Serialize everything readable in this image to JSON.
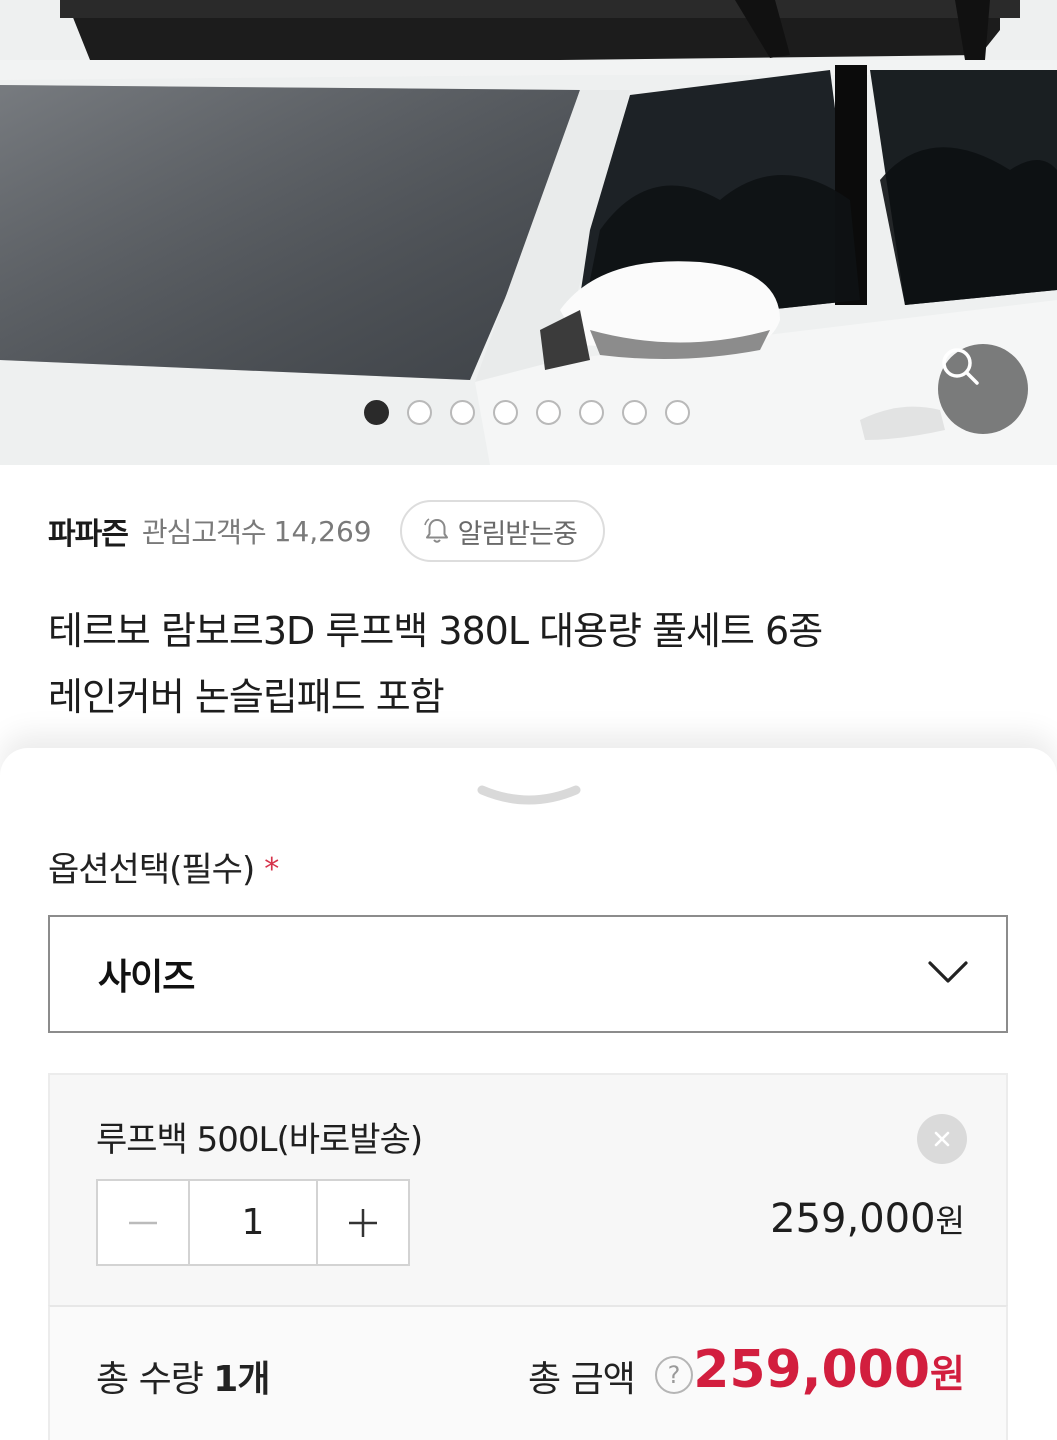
{
  "gallery": {
    "image_alt": "roof bag on white car",
    "slide_count": 8,
    "active_index": 0,
    "zoom_icon": "search-icon"
  },
  "store": {
    "name": "파파즌",
    "followers_label": "관심고객수",
    "followers_count": "14,269",
    "alarm_label": "알림받는중",
    "alarm_icon": "bell-icon"
  },
  "product": {
    "title_line1": "테르보 람보르3D 루프백 380L 대용량 풀세트 6종",
    "title_line2": "레인커버 논슬립패드 포함"
  },
  "options": {
    "section_label": "옵션선택(필수)",
    "required_mark": "*",
    "select_value": "사이즈",
    "selected_item": {
      "name": "루프백 500L(바로발송)",
      "quantity": "1",
      "price": "259,000",
      "currency": "원"
    }
  },
  "summary": {
    "total_qty_label": "총 수량",
    "total_qty_value": "1개",
    "total_amount_label": "총 금액",
    "help_symbol": "?",
    "total_amount": "259,000",
    "currency": "원"
  },
  "colors": {
    "accent_price": "#d21e3e",
    "required_mark": "#d6334b",
    "zoom_button": "#5f5f5f"
  }
}
